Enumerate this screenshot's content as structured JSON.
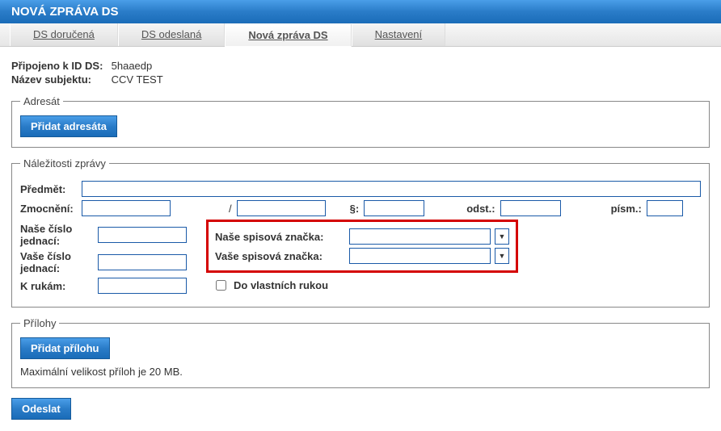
{
  "header": {
    "title": "NOVÁ ZPRÁVA DS"
  },
  "tabs": {
    "dorucena": "DS doručená",
    "odeslana": "DS odeslaná",
    "nova": "Nová zpráva DS",
    "nastaveni": "Nastavení"
  },
  "conn": {
    "id_label": "Připojeno k ID DS:",
    "id_value": "5haaedp",
    "subj_label": "Název subjektu:",
    "subj_value": "CCV TEST"
  },
  "adresat": {
    "legend": "Adresát",
    "add_btn": "Přidat adresáta"
  },
  "nalez": {
    "legend": "Náležitosti zprávy",
    "predmet": "Předmět:",
    "zmocneni": "Zmocnění:",
    "slash": "/",
    "paragraph": "§:",
    "odst": "odst.:",
    "pism": "písm.:",
    "nase_cislo": "Naše číslo jednací:",
    "vase_cislo": "Vaše číslo jednací:",
    "k_rukam": "K rukám:",
    "nase_znacka": "Naše spisová značka:",
    "vase_znacka": "Vaše spisová značka:",
    "vlastni": "Do vlastních rukou"
  },
  "prilohy": {
    "legend": "Přílohy",
    "add_btn": "Přidat přílohu",
    "hint": "Maximální velikost příloh je 20 MB."
  },
  "send_btn": "Odeslat"
}
